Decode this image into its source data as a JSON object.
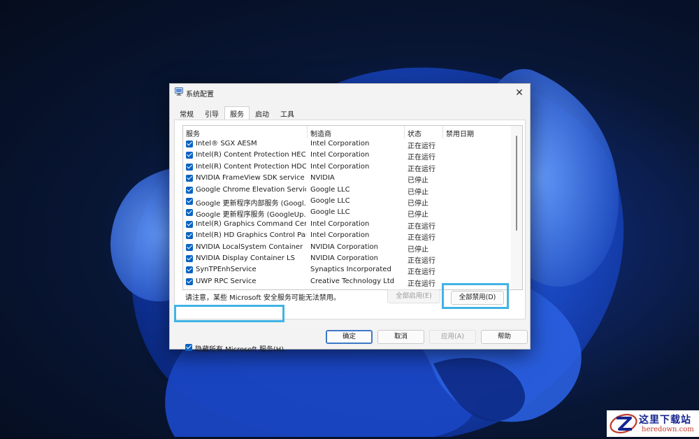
{
  "window": {
    "title": "系统配置",
    "close_glyph": "✕"
  },
  "tabs": [
    {
      "label": "常规",
      "active": false
    },
    {
      "label": "引导",
      "active": false
    },
    {
      "label": "服务",
      "active": true
    },
    {
      "label": "启动",
      "active": false
    },
    {
      "label": "工具",
      "active": false
    }
  ],
  "services_table": {
    "columns": [
      "服务",
      "制造商",
      "状态",
      "禁用日期"
    ],
    "rows": [
      {
        "name": "Intel® SGX AESM",
        "manufacturer": "Intel Corporation",
        "status": "正在运行",
        "checked": true
      },
      {
        "name": "Intel(R) Content Protection HECI ...",
        "manufacturer": "Intel Corporation",
        "status": "正在运行",
        "checked": true
      },
      {
        "name": "Intel(R) Content Protection HDCP...",
        "manufacturer": "Intel Corporation",
        "status": "正在运行",
        "checked": true
      },
      {
        "name": "NVIDIA FrameView SDK service",
        "manufacturer": "NVIDIA",
        "status": "已停止",
        "checked": true
      },
      {
        "name": "Google Chrome Elevation Servic...",
        "manufacturer": "Google LLC",
        "status": "已停止",
        "checked": true
      },
      {
        "name": "Google 更新程序内部服务 (Googl...",
        "manufacturer": "Google LLC",
        "status": "已停止",
        "checked": true
      },
      {
        "name": "Google 更新程序服务 (GoogleUp...",
        "manufacturer": "Google LLC",
        "status": "已停止",
        "checked": true
      },
      {
        "name": "Intel(R) Graphics Command Cent...",
        "manufacturer": "Intel Corporation",
        "status": "正在运行",
        "checked": true
      },
      {
        "name": "Intel(R) HD Graphics Control Pan...",
        "manufacturer": "Intel Corporation",
        "status": "正在运行",
        "checked": true
      },
      {
        "name": "NVIDIA LocalSystem Container",
        "manufacturer": "NVIDIA Corporation",
        "status": "已停止",
        "checked": true
      },
      {
        "name": "NVIDIA Display Container LS",
        "manufacturer": "NVIDIA Corporation",
        "status": "正在运行",
        "checked": true
      },
      {
        "name": "SynTPEnhService",
        "manufacturer": "Synaptics Incorporated",
        "status": "正在运行",
        "checked": true
      },
      {
        "name": "UWP RPC Service",
        "manufacturer": "Creative Technology Ltd",
        "status": "正在运行",
        "checked": true
      }
    ]
  },
  "note": "请注意，某些 Microsoft 安全服务可能无法禁用。",
  "buttons": {
    "enable_all": "全部启用(E)",
    "disable_all": "全部禁用(D)",
    "ok": "确定",
    "cancel": "取消",
    "apply": "应用(A)",
    "help": "帮助"
  },
  "hide_microsoft": {
    "label": "隐藏所有 Microsoft 服务(H)",
    "checked": true
  },
  "colors": {
    "checkbox": "#0a64c2",
    "highlight": "#41b3e6"
  },
  "watermark": {
    "name": "这里下载站",
    "url": "heredown.com"
  }
}
